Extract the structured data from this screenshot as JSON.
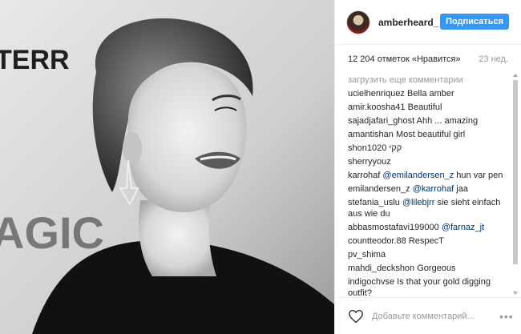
{
  "post": {
    "username": "amberheard_",
    "follow_label": "Подписаться",
    "likes": "12 204 отметок «Нравится»",
    "time": "23 нед.",
    "load_more": "загрузить еще комментарии",
    "comment_placeholder": "Добавьте комментарий...",
    "more_label": "•••"
  },
  "photo": {
    "sign_text_1": "TERR",
    "sign_text_2": "AGIC"
  },
  "comments": [
    {
      "user": "ucielhenriquez",
      "parts": [
        {
          "text": "Bella amber"
        }
      ]
    },
    {
      "user": "amir.koosha41",
      "parts": [
        {
          "text": "Beautiful"
        }
      ]
    },
    {
      "user": "sajadjafari_ghost",
      "parts": [
        {
          "text": "Ahh ... amazing"
        }
      ]
    },
    {
      "user": "amantishan",
      "parts": [
        {
          "text": "Most beautiful girl"
        }
      ]
    },
    {
      "user": "shon1020",
      "parts": [
        {
          "text": "קקי"
        }
      ]
    },
    {
      "user": "sherryyouz",
      "parts": [
        {
          "text": ""
        }
      ]
    },
    {
      "user": "karrohaf",
      "parts": [
        {
          "text": "@emilandersen_z",
          "mention": true
        },
        {
          "text": " hun var pen"
        }
      ]
    },
    {
      "user": "emilandersen_z",
      "parts": [
        {
          "text": "@karrohaf",
          "mention": true
        },
        {
          "text": " jaa"
        }
      ]
    },
    {
      "user": "stefania_uslu",
      "parts": [
        {
          "text": "@lilebjrr",
          "mention": true
        },
        {
          "text": " sie sieht einfach aus wie du"
        }
      ]
    },
    {
      "user": "abbasmostafavi199000",
      "parts": [
        {
          "text": "@farnaz_jt",
          "mention": true
        }
      ]
    },
    {
      "user": "countteodor.88",
      "parts": [
        {
          "text": "RespecT"
        }
      ]
    },
    {
      "user": "pv_shima",
      "parts": [
        {
          "text": ""
        }
      ]
    },
    {
      "user": "mahdi_deckshon",
      "parts": [
        {
          "text": "Gorgeous"
        }
      ]
    },
    {
      "user": "indigochvse",
      "parts": [
        {
          "text": "Is that your gold digging outfit?"
        }
      ]
    }
  ]
}
